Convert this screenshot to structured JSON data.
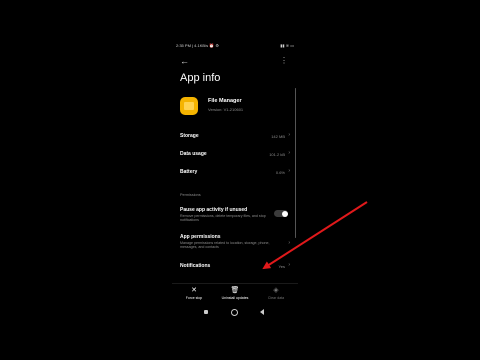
{
  "status": {
    "time_info": "2:35 PM | 4.1KB/s ⏰ ⚙",
    "indicators": "▮▮ ≋ ▭"
  },
  "header": {
    "title": "App info",
    "back_icon": "back-arrow-icon",
    "more_icon": "more-vert-icon"
  },
  "app": {
    "name": "File Manager",
    "version": "Version: V1-210601",
    "icon": "folder-icon",
    "icon_color": "#f5b400"
  },
  "rows": [
    {
      "label": "Storage",
      "value": "142 MB"
    },
    {
      "label": "Data usage",
      "value": "101.2 kB"
    },
    {
      "label": "Battery",
      "value": "0.6%"
    }
  ],
  "permissions_section": "Permissions",
  "pause_activity": {
    "label": "Pause app activity if unused",
    "desc": "Remove permissions, delete temporary files, and stop notifications",
    "enabled": false
  },
  "app_permissions": {
    "label": "App permissions",
    "desc": "Manage permissions related to location, storage, phone, messages, and contacts"
  },
  "notifications": {
    "label": "Notifications",
    "value": "Yes"
  },
  "bottom_actions": [
    {
      "label": "Force stop",
      "icon": "close-icon"
    },
    {
      "label": "Uninstall updates",
      "icon": "trash-icon"
    },
    {
      "label": "Clear data",
      "icon": "eraser-icon",
      "disabled": true
    }
  ],
  "annotation": {
    "color": "#e0191b"
  }
}
